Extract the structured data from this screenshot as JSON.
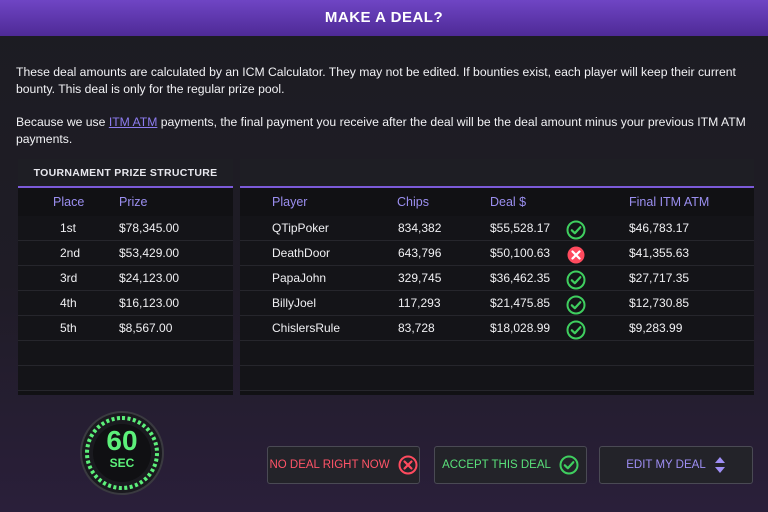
{
  "title": "MAKE A DEAL?",
  "intro": {
    "line1": "These deal amounts are calculated by an ICM Calculator.  They may not be edited.  If bounties exist, each player will keep their current bounty.  This deal is only for the regular prize pool.",
    "line2_before": "Because we use ",
    "line2_link": "ITM ATM",
    "line2_after": " payments, the final payment you receive after the deal will be the deal amount minus your previous ITM ATM payments."
  },
  "prize_structure": {
    "title": "TOURNAMENT PRIZE STRUCTURE",
    "columns": [
      "Place",
      "Prize"
    ],
    "rows": [
      {
        "place": "1st",
        "prize": "$78,345.00"
      },
      {
        "place": "2nd",
        "prize": "$53,429.00"
      },
      {
        "place": "3rd",
        "prize": "$24,123.00"
      },
      {
        "place": "4th",
        "prize": "$16,123.00"
      },
      {
        "place": "5th",
        "prize": "$8,567.00"
      }
    ]
  },
  "deal_table": {
    "columns": [
      "Player",
      "Chips",
      "Deal $",
      "Final ITM ATM"
    ],
    "rows": [
      {
        "player": "QTipPoker",
        "chips": "834,382",
        "deal": "$55,528.17",
        "status": "accepted",
        "final": "$46,783.17"
      },
      {
        "player": "DeathDoor",
        "chips": "643,796",
        "deal": "$50,100.63",
        "status": "rejected",
        "final": "$41,355.63"
      },
      {
        "player": "PapaJohn",
        "chips": "329,745",
        "deal": "$36,462.35",
        "status": "accepted",
        "final": "$27,717.35"
      },
      {
        "player": "BillyJoel",
        "chips": "117,293",
        "deal": "$21,475.85",
        "status": "accepted",
        "final": "$12,730.85"
      },
      {
        "player": "ChislersRule",
        "chips": "83,728",
        "deal": "$18,028.99",
        "status": "accepted",
        "final": "$9,283.99"
      }
    ]
  },
  "timer": {
    "value": "60",
    "unit": "SEC",
    "remaining_fraction": 0.75
  },
  "buttons": {
    "no_deal": "NO DEAL RIGHT NOW",
    "accept": "ACCEPT THIS DEAL",
    "edit": "EDIT MY DEAL"
  },
  "colors": {
    "accent": "#7b5ad8",
    "accept": "#3fce5f",
    "reject": "#ff4a5e",
    "timer": "#5cf07a"
  }
}
